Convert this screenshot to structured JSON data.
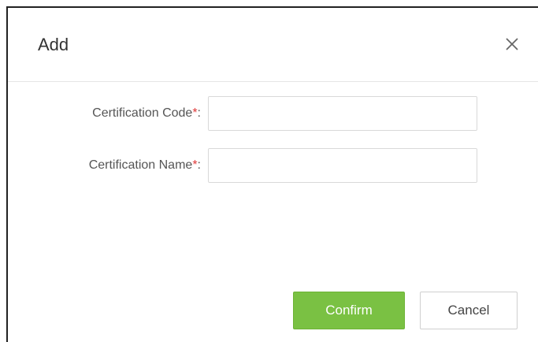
{
  "dialog": {
    "title": "Add",
    "close_icon": "close-icon"
  },
  "form": {
    "fields": [
      {
        "label": "Certification Code",
        "required_mark": "*",
        "colon": ":",
        "value": "",
        "placeholder": ""
      },
      {
        "label": "Certification Name",
        "required_mark": "*",
        "colon": ":",
        "value": "",
        "placeholder": ""
      }
    ]
  },
  "footer": {
    "confirm_label": "Confirm",
    "cancel_label": "Cancel"
  },
  "colors": {
    "confirm_bg": "#7ac143",
    "required": "#e03a3a",
    "border": "#d9d9d9"
  }
}
